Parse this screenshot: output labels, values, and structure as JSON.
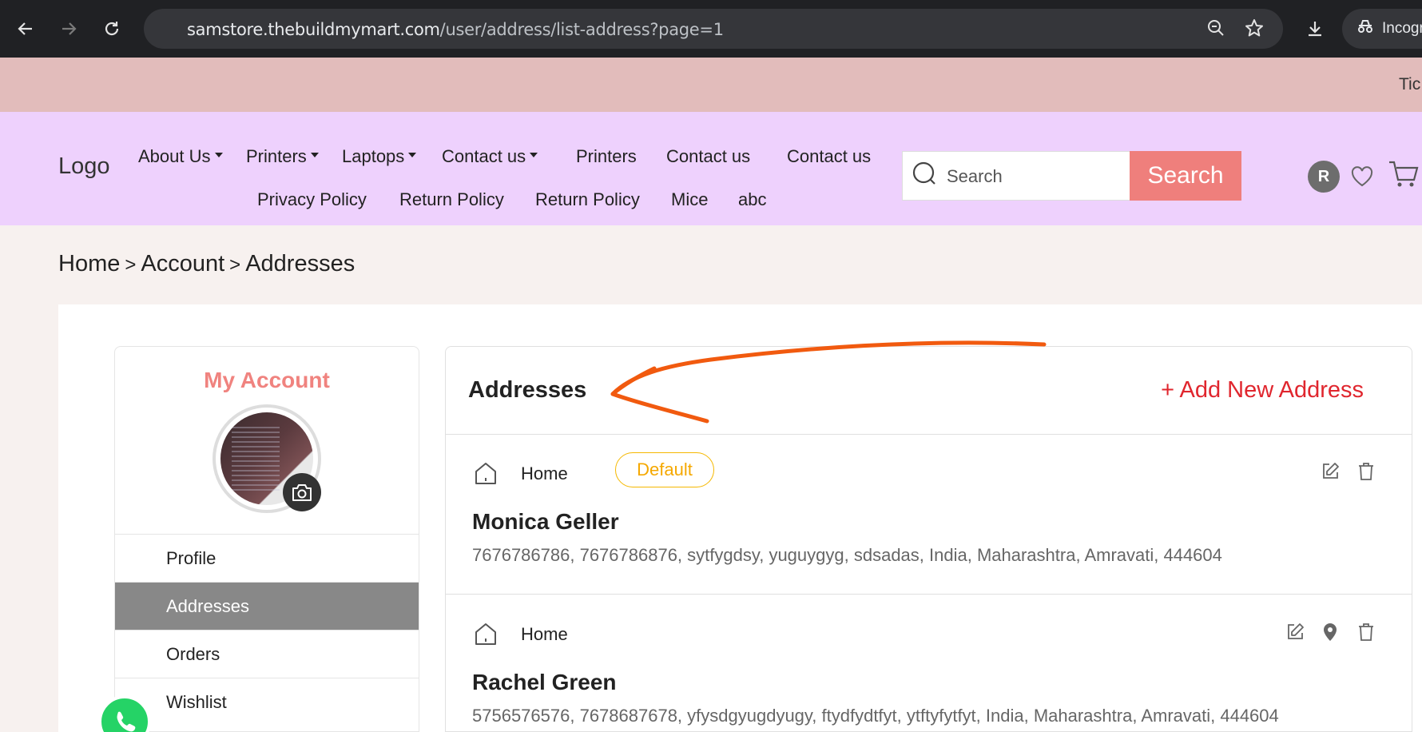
{
  "browser": {
    "url_host": "samstore.thebuildmymart.com",
    "url_path": "/user/address/list-address?page=1",
    "incognito_label": "Incognito"
  },
  "announcement": {
    "text": "Tic"
  },
  "header": {
    "logo": "Logo",
    "nav_row1": [
      {
        "label": "About Us",
        "dropdown": true
      },
      {
        "label": "Printers",
        "dropdown": true
      },
      {
        "label": "Laptops",
        "dropdown": true
      },
      {
        "label": "Contact us",
        "dropdown": true
      },
      {
        "label": "Printers",
        "dropdown": false
      },
      {
        "label": "Contact us",
        "dropdown": false
      },
      {
        "label": "Contact us",
        "dropdown": false
      }
    ],
    "nav_row2": [
      {
        "label": "Privacy Policy"
      },
      {
        "label": "Return Policy"
      },
      {
        "label": "Return Policy"
      },
      {
        "label": "Mice"
      },
      {
        "label": "abc"
      }
    ],
    "search_placeholder": "Search",
    "search_button": "Search",
    "avatar_initial": "R"
  },
  "breadcrumb": [
    "Home",
    "Account",
    "Addresses"
  ],
  "sidebar": {
    "title": "My Account",
    "items": [
      {
        "label": "Profile",
        "active": false
      },
      {
        "label": "Addresses",
        "active": true
      },
      {
        "label": "Orders",
        "active": false
      },
      {
        "label": "Wishlist",
        "active": false
      }
    ]
  },
  "addresses": {
    "title": "Addresses",
    "add_new": "+ Add New Address",
    "list": [
      {
        "type": "Home",
        "default_label": "Default",
        "name": "Monica Geller",
        "details": "7676786786, 7676786876, sytfygdsy, yuguygyg, sdsadas, India, Maharashtra, Amravati, 444604"
      },
      {
        "type": "Home",
        "name": "Rachel Green",
        "details": "5756576576, 7678687678, yfysdgyugdyugy, ftydfydtfyt, ytftyfytfyt, India, Maharashtra, Amravati, 444604"
      }
    ]
  },
  "colors": {
    "accent_red": "#e0262e",
    "search_btn": "#ef7f7c",
    "header_bg": "#eed1fd",
    "announce_bg": "#e2bcbb",
    "default_badge": "#f5b800",
    "annotation_arrow": "#f15a0f"
  }
}
